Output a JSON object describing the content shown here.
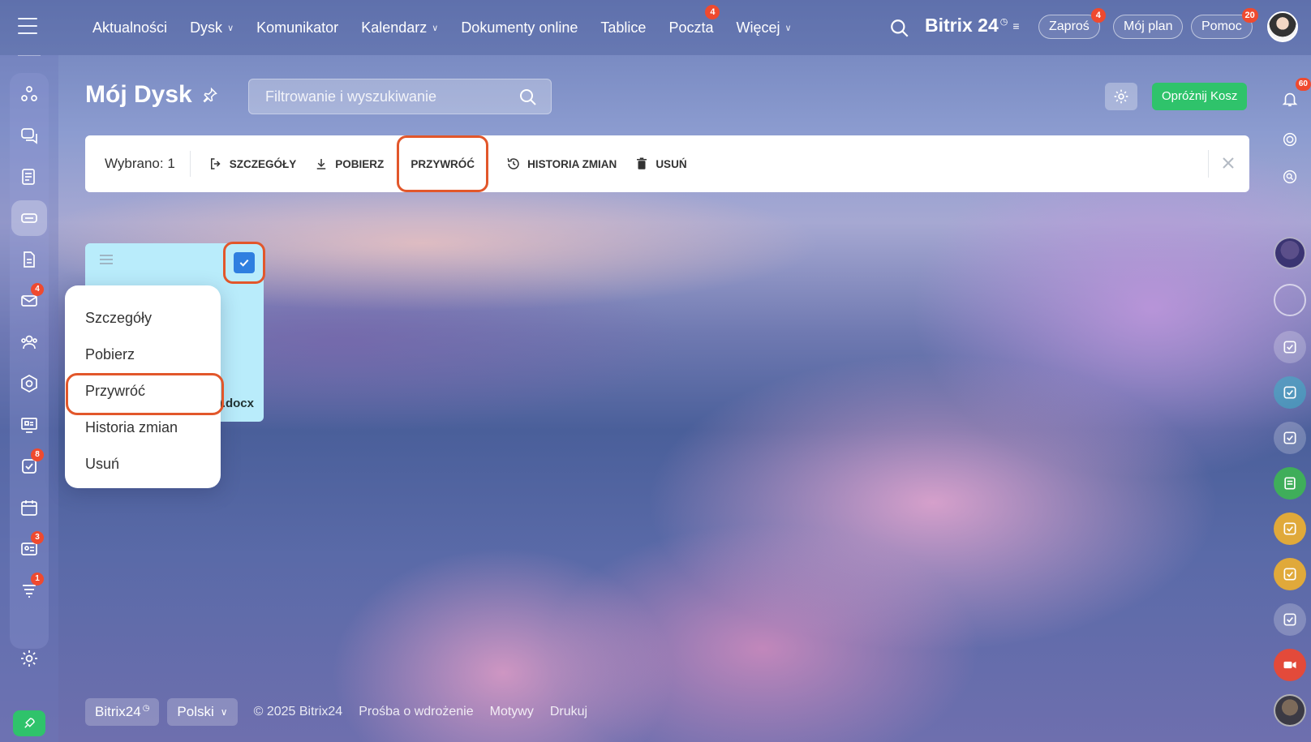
{
  "topbar": {
    "nav": [
      {
        "label": "Aktualności",
        "dropdown": false
      },
      {
        "label": "Dysk",
        "dropdown": true
      },
      {
        "label": "Komunikator",
        "dropdown": false
      },
      {
        "label": "Kalendarz",
        "dropdown": true
      },
      {
        "label": "Dokumenty online",
        "dropdown": false
      },
      {
        "label": "Tablice",
        "dropdown": false
      },
      {
        "label": "Poczta",
        "dropdown": false,
        "badge": "4"
      },
      {
        "label": "Więcej",
        "dropdown": true
      }
    ],
    "brand": "Bitrix 24",
    "invite": {
      "label": "Zaproś",
      "badge": "4"
    },
    "plan": {
      "label": "Mój plan"
    },
    "help": {
      "label": "Pomoc",
      "badge": "20"
    }
  },
  "sidebar": {
    "badges": {
      "mail": "4",
      "tasks": "8",
      "crm": "3",
      "funnel": "1"
    }
  },
  "rightbar": {
    "notifications_badge": "60"
  },
  "page": {
    "title": "Mój Dysk",
    "filter_placeholder": "Filtrowanie i wyszukiwanie",
    "empty_trash": "Opróżnij Kosz"
  },
  "actionbar": {
    "selected": "Wybrano: 1",
    "actions": {
      "details": "SZCZEGÓŁY",
      "download": "POBIERZ",
      "restore": "PRZYWRÓĆ",
      "history": "HISTORIA ZMIAN",
      "delete": "USUŃ"
    }
  },
  "file": {
    "name_visible": ").docx"
  },
  "context_menu": {
    "items": [
      "Szczegóły",
      "Pobierz",
      "Przywróć",
      "Historia zmian",
      "Usuń"
    ]
  },
  "footer": {
    "brand": "Bitrix24",
    "language": "Polski",
    "copyright": "© 2025 Bitrix24",
    "links": [
      "Prośba o wdrożenie",
      "Motywy",
      "Drukuj"
    ]
  },
  "colors": {
    "accent_green": "#2fc36b",
    "badge_red": "#ef4a2f",
    "highlight_orange": "#e2572b",
    "checkbox_blue": "#2f7fe0"
  }
}
